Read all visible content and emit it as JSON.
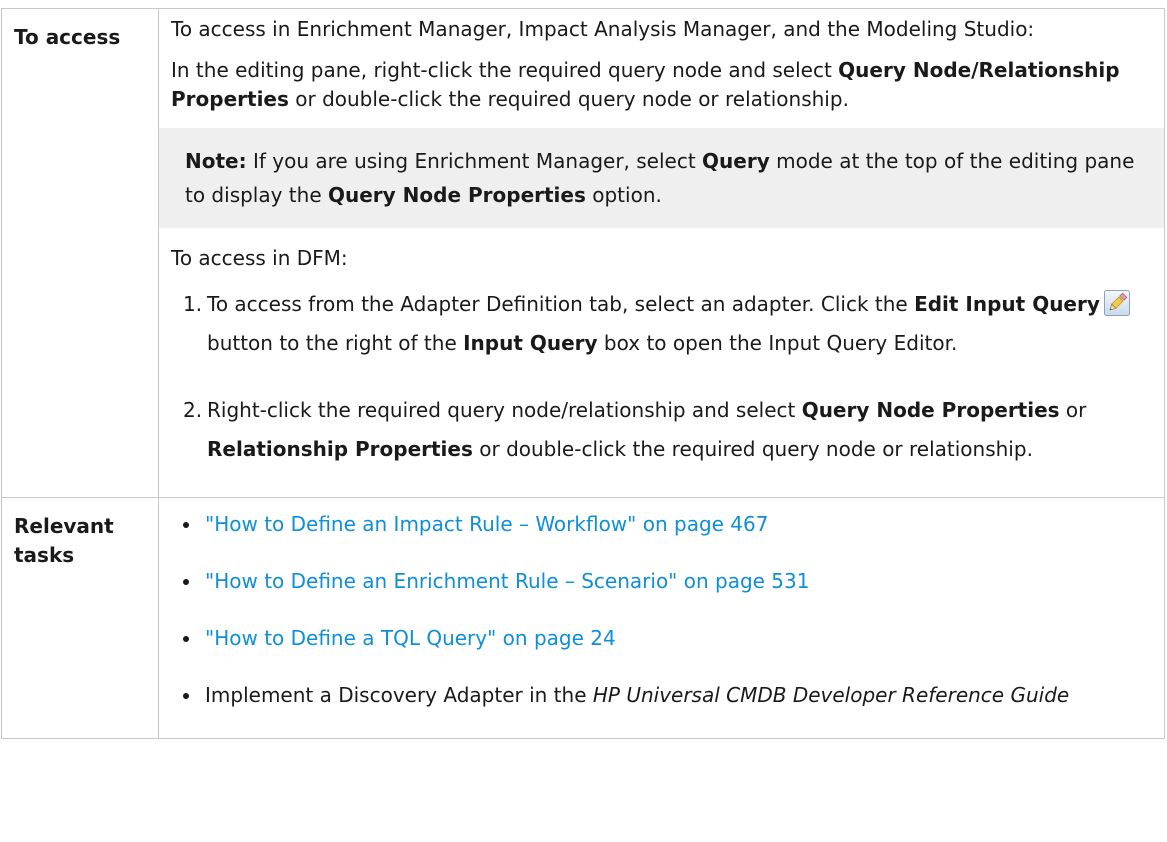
{
  "access": {
    "label": "To access",
    "intro": "To access in Enrichment Manager, Impact Analysis Manager, and the Modeling Studio:",
    "p1_pre": "In the editing pane, right-click the required query node and select ",
    "p1_bold": "Query Node/Relationship Properties",
    "p1_post": " or double-click the required query node or relationship.",
    "note": {
      "label": "Note:",
      "pre": " If you are using Enrichment Manager, select ",
      "bold1": "Query",
      "mid": " mode at the top of the editing pane to display the ",
      "bold2": "Query Node Properties",
      "post": " option."
    },
    "dfm_intro": "To access in DFM:",
    "steps": [
      {
        "num": "1.",
        "pre": "To access from the Adapter Definition tab, select an adapter. Click the ",
        "bold1": "Edit Input Query",
        "icon": "pencil-icon",
        "mid": " button to the right of the ",
        "bold2": "Input Query",
        "post": " box to open the Input Query Editor."
      },
      {
        "num": "2.",
        "pre": "Right-click the required query node/relationship and select ",
        "bold1": "Query Node Properties",
        "mid": " or ",
        "bold2": "Relationship Properties",
        "post": " or double-click the required query node or relationship."
      }
    ]
  },
  "tasks": {
    "label": "Relevant tasks",
    "links": [
      "\"How to Define an Impact Rule – Workflow\" on page 467",
      "\"How to Define an Enrichment Rule – Scenario\" on page 531",
      "\"How to Define a TQL Query\" on page 24"
    ],
    "last_item": {
      "pre": "Implement a Discovery Adapter in the ",
      "italic": "HP Universal CMDB Developer Reference Guide"
    }
  },
  "colors": {
    "link": "#0f8fd6",
    "note_background": "#efefef",
    "border": "#c8c8c8"
  }
}
